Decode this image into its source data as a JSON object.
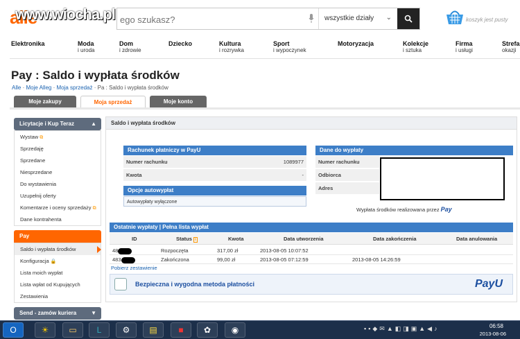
{
  "header": {
    "logo": "alle",
    "watermark": "www.wiocha.pl",
    "search_placeholder": "ego szukasz?",
    "category_select": "wszystkie działy",
    "basket_label": "koszyk jest pusty",
    "accent": "#ff6600"
  },
  "categories": [
    {
      "name": "Elektronika",
      "sub": ""
    },
    {
      "name": "Moda",
      "sub": "i uroda"
    },
    {
      "name": "Dom",
      "sub": "i zdrowie"
    },
    {
      "name": "Dziecko",
      "sub": ""
    },
    {
      "name": "Kultura",
      "sub": "i rozrywka"
    },
    {
      "name": "Sport",
      "sub": "i wypoczynek"
    },
    {
      "name": "Motoryzacja",
      "sub": ""
    },
    {
      "name": "Kolekcje",
      "sub": "i sztuka"
    },
    {
      "name": "Firma",
      "sub": "i usługi"
    },
    {
      "name": "Strefa",
      "sub": "okazji"
    }
  ],
  "page": {
    "title": "Pay : Saldo i wypłata środków",
    "breadcrumb": [
      "Alle",
      "Moje Alleg",
      "Moja sprzedaż",
      "Pa  : Saldo i wypłata środków"
    ]
  },
  "tabs": [
    "Moje zakupy",
    "Moja sprzedaż",
    "Moje konto"
  ],
  "sidebar": {
    "section1_title": "Licytacje i Kup Teraz",
    "section1_items": [
      "Wystaw",
      "Sprzedaję",
      "Sprzedane",
      "Niesprzedane",
      "Do wystawienia",
      "Uzupełnij oferty",
      "Komentarze i oceny sprzedaży",
      "Dane kontrahenta"
    ],
    "section2_title": "Pay",
    "section2_items": [
      "Saldo i wypłata środków",
      "Konfiguracja",
      "Lista moich wypłat",
      "Lista wpłat od Kupujących",
      "Zestawienia"
    ],
    "section3_title": "Send  - zamów kuriera"
  },
  "main": {
    "title": "Saldo i wypłata środków",
    "account_box_title": "Rachunek płatniczy w PayU",
    "account_number_label": "Numer rachunku",
    "account_number_value": "1089977",
    "amount_label": "Kwota",
    "amount_value": "-",
    "auto_title": "Opcje autowypłat",
    "auto_value": "Autowypłaty wyłączone",
    "payout_title": "Dane do wypłaty",
    "payout_labels": [
      "Numer rachunku",
      "Odbiorca",
      "Adres"
    ],
    "payout_note": "Wypłata środków realizowana przez",
    "payout_note_brand": "Pay",
    "table_title": "Ostatnie wypłaty | Pełna lista wypłat",
    "table_columns": [
      "ID",
      "Status",
      "Kwota",
      "Data utworzenia",
      "Data zakończenia",
      "Data anulowania"
    ],
    "table_rows": [
      {
        "id": "48",
        "status": "Rozpoczęta",
        "amount": "317,00 zł",
        "created": "2013-08-05 10:07:52",
        "finished": "",
        "cancelled": ""
      },
      {
        "id": "483",
        "status": "Zakończona",
        "amount": "99,00 zł",
        "created": "2013-08-05 07:12:59",
        "finished": "2013-08-05 14:26:59",
        "cancelled": ""
      }
    ],
    "download_link": "Pobierz zestawienie",
    "secure_text": "Bezpieczna i wygodna metoda płatności",
    "payu_logo": "PayU"
  },
  "taskbar": {
    "time": "06:58",
    "date": "2013-08-06"
  }
}
